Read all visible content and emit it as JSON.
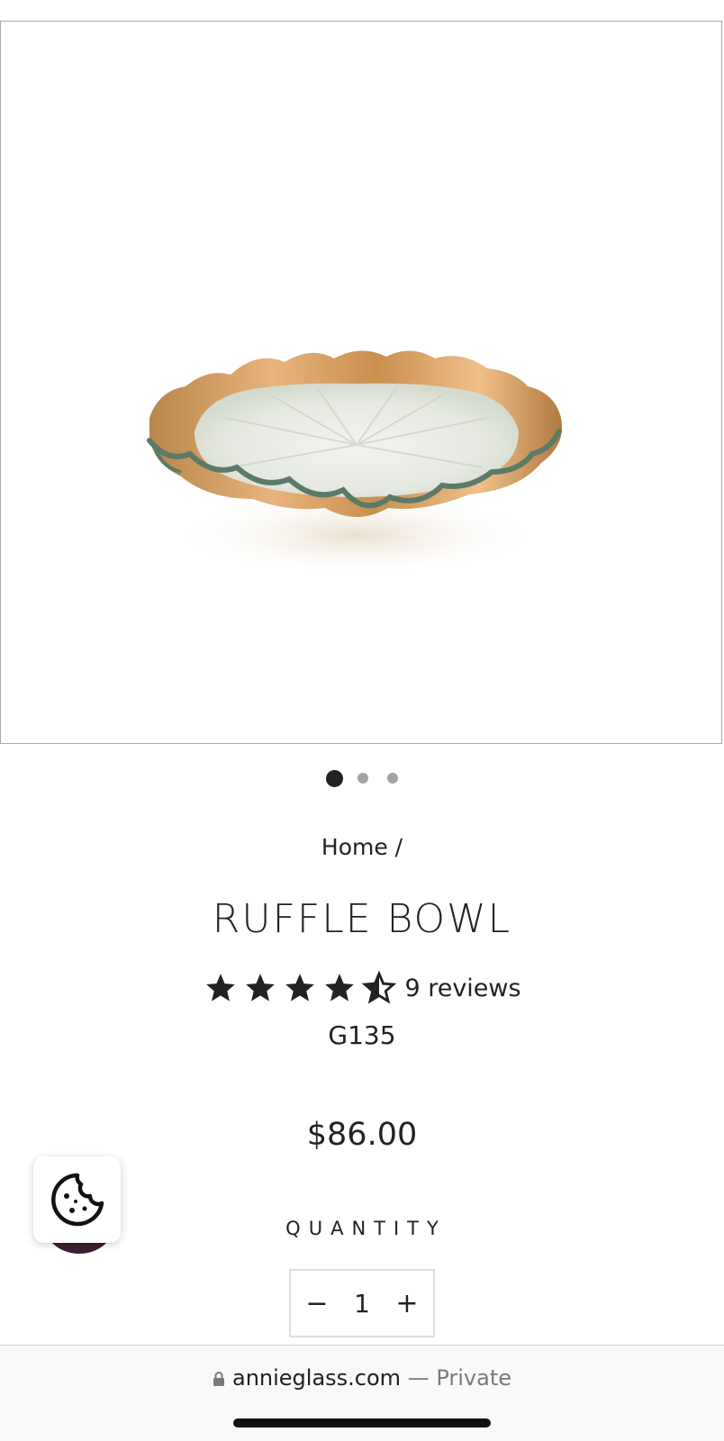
{
  "product": {
    "image_alt": "Ruffle bowl product image",
    "gallery_dots": 3,
    "active_dot": 0,
    "breadcrumb": "Home /",
    "title": "RUFFLE BOWL",
    "rating": 4.5,
    "reviews_label": "9 reviews",
    "sku": "G135",
    "price": "$86.00"
  },
  "quantity": {
    "label": "QUANTITY",
    "minus": "−",
    "value": "1",
    "plus": "+"
  },
  "browser": {
    "domain": "annieglass.com",
    "private_label": " — Private"
  },
  "colors": {
    "gold": "#c98f4e",
    "glass_edge": "#5c7a68",
    "text": "#222222"
  }
}
